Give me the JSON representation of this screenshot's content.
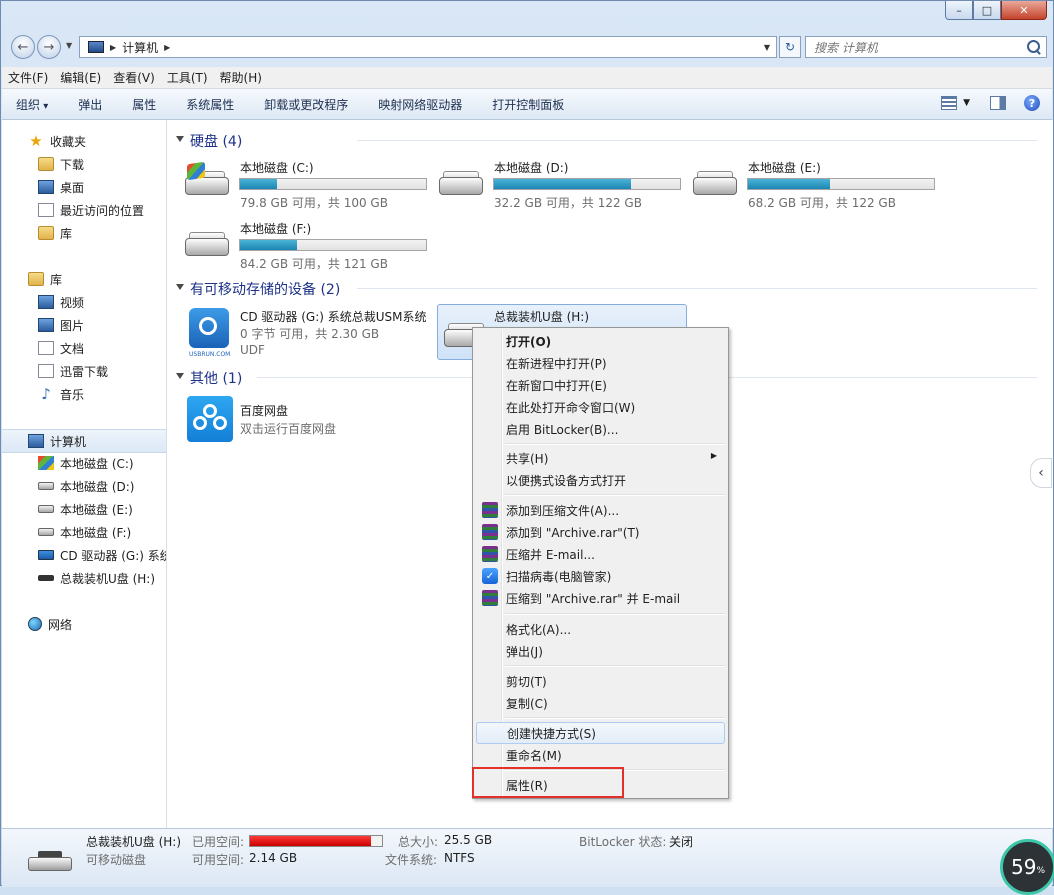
{
  "window": {
    "minimize": "▭",
    "maximize": "□",
    "close": "✕"
  },
  "address": {
    "crumb": "计算机",
    "search_placeholder": "搜索 计算机"
  },
  "menubar": [
    "文件(F)",
    "编辑(E)",
    "查看(V)",
    "工具(T)",
    "帮助(H)"
  ],
  "toolbar": [
    "组织",
    "弹出",
    "属性",
    "系统属性",
    "卸载或更改程序",
    "映射网络驱动器",
    "打开控制面板"
  ],
  "nav": {
    "favorites": "收藏夹",
    "fav_items": [
      "下载",
      "桌面",
      "最近访问的位置",
      "库"
    ],
    "libraries": "库",
    "lib_items": [
      "视频",
      "图片",
      "文档",
      "迅雷下载",
      "音乐"
    ],
    "computer": "计算机",
    "comp_items": [
      "本地磁盘 (C:)",
      "本地磁盘 (D:)",
      "本地磁盘 (E:)",
      "本地磁盘 (F:)",
      "CD 驱动器 (G:) 系统",
      "总裁装机U盘 (H:)"
    ],
    "network": "网络"
  },
  "groups": {
    "hdd": "硬盘 (4)",
    "removable": "有可移动存储的设备 (2)",
    "other": "其他 (1)"
  },
  "drives": [
    {
      "name": "本地磁盘 (C:)",
      "info": "79.8 GB 可用，共 100 GB",
      "used": 0.2
    },
    {
      "name": "本地磁盘 (D:)",
      "info": "32.2 GB 可用，共 122 GB",
      "used": 0.736
    },
    {
      "name": "本地磁盘 (E:)",
      "info": "68.2 GB 可用，共 122 GB",
      "used": 0.441
    },
    {
      "name": "本地磁盘 (F:)",
      "info": "84.2 GB 可用，共 121 GB",
      "used": 0.304
    }
  ],
  "cd": {
    "name": "CD 驱动器 (G:) 系统总裁USM系统",
    "info": "0 字节 可用，共 2.30 GB",
    "fs": "UDF",
    "logo_text": "USBRUN.COM"
  },
  "usb": {
    "name": "总裁装机U盘 (H:)"
  },
  "baidu": {
    "name": "百度网盘",
    "desc": "双击运行百度网盘"
  },
  "context_menu": {
    "items": [
      "打开(O)",
      "在新进程中打开(P)",
      "在新窗口中打开(E)",
      "在此处打开命令窗口(W)",
      "启用 BitLocker(B)...",
      "共享(H)",
      "以便携式设备方式打开",
      "添加到压缩文件(A)...",
      "添加到 \"Archive.rar\"(T)",
      "压缩并 E-mail...",
      "扫描病毒(电脑管家)",
      "压缩到 \"Archive.rar\" 并 E-mail",
      "格式化(A)...",
      "弹出(J)",
      "剪切(T)",
      "复制(C)",
      "创建快捷方式(S)",
      "重命名(M)",
      "属性(R)"
    ]
  },
  "status": {
    "name": "总裁装机U盘 (H:)",
    "type": "可移动磁盘",
    "used_label": "已用空间:",
    "free_label": "可用空间:",
    "free_value": "2.14 GB",
    "total_label": "总大小:",
    "total_value": "25.5 GB",
    "fs_label": "文件系统:",
    "fs_value": "NTFS",
    "bitlocker_label": "BitLocker 状态:",
    "bitlocker_value": "关闭",
    "used_fraction": 0.92
  },
  "gauge": {
    "value": "59",
    "unit": "%"
  }
}
